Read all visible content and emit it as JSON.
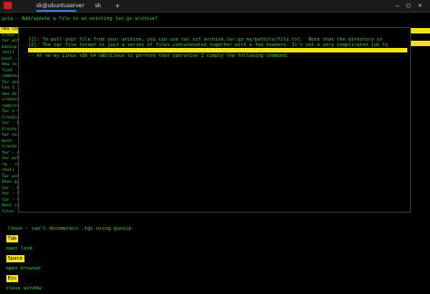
{
  "window": {
    "tabs": [
      {
        "label": "sk@ubuntuserver",
        "active": true
      },
      {
        "label": "sk",
        "active": false
      }
    ],
    "new_tab_symbol": "+",
    "controls": [
      "–",
      "▢",
      "✕"
    ]
  },
  "terminal": {
    "header_line": "gzip - Add/update a file to an existing tar.gz archive?",
    "left_column": [
      "How can",
      "Linux -",
      "tar wit",
      "backup",
      "shell -",
      "bash -",
      "How to",
      "find -",
      "command",
      "Tar and",
      "Can I j",
      "How do",
      "creatin",
      "compres",
      "Tar a f",
      "Creatin",
      "tar - E",
      "Create",
      "tar exi",
      "bash -",
      "Create",
      "tar - A",
      "tar wit",
      "rm - re",
      "shell",
      "Tar wit",
      "Does gz",
      "tar - E",
      "tar - S",
      "tar - C",
      "Bash sc",
      "files"
    ],
    "left_highlight_index": 0,
    "bottom_left_text": "linux - can't decompress .tgz using gunzip"
  },
  "panel": {
    "lines": [
      "[1]: To pull your file from your archive, you can use tar xzf archive.tar.gz my/path/to/file.txt.  Note that the directory in",
      "[2]: The tar file format is just a series of files concatenated together with a few headers. It's not a very complicated job to",
      "",
      "",
      "",
      "-- At on my Linux x86_64 GNU/Linux to perform that operation I simply the following command:"
    ]
  },
  "statusbar": {
    "items": [
      {
        "key": "Tab",
        "label": "open link"
      },
      {
        "key": "Space",
        "label": "open browser"
      },
      {
        "key": "Esc",
        "label": "close window"
      }
    ]
  },
  "colors": {
    "terminal_green": "#36d13a",
    "highlight_yellow": "#f0e21a",
    "background": "#000000",
    "app_icon_red": "#d71920",
    "active_tab_underline": "#3a7bd5"
  }
}
